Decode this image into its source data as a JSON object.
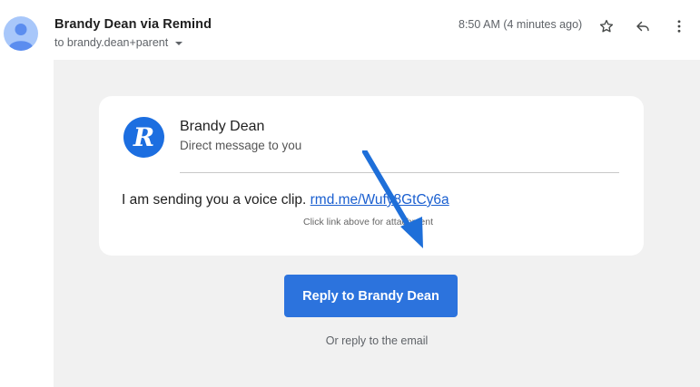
{
  "header": {
    "sender": "Brandy Dean via Remind",
    "recipient": "to brandy.dean+parent",
    "timestamp": "8:50 AM (4 minutes ago)",
    "icons": [
      "avatar",
      "star-icon",
      "reply-icon",
      "more-vert-icon"
    ]
  },
  "card": {
    "logo_letter": "R",
    "name": "Brandy Dean",
    "subtitle": "Direct message to you",
    "message_text": "I am sending you a voice clip. ",
    "link_text": "rmd.me/Wufy8GtCy6a",
    "hint": "Click link above for attachment"
  },
  "actions": {
    "reply_button": "Reply to Brandy Dean",
    "alt_reply": "Or reply to the email"
  },
  "colors": {
    "brand_blue": "#1c6ee0",
    "button_blue": "#2c73dd",
    "link_blue": "#1a5fd0",
    "arrow_blue": "#1e6fd9",
    "body_bg": "#f1f1f1"
  }
}
